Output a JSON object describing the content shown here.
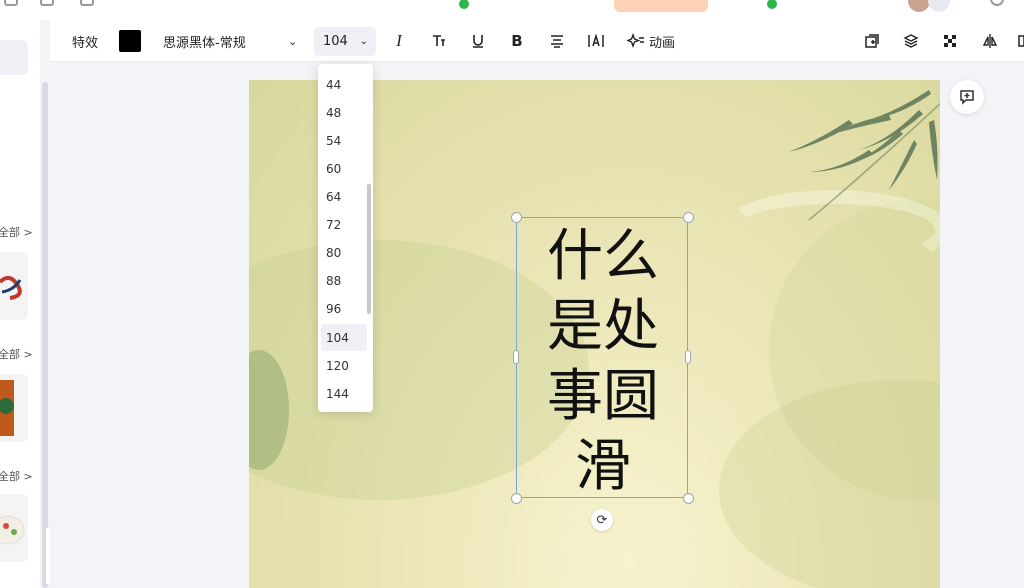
{
  "toolbar": {
    "effects_label": "特效",
    "text_color": "#000000",
    "font_name": "思源黑体-常规",
    "font_size": "104",
    "animation_label": "动画"
  },
  "font_size_dropdown": {
    "options": [
      "44",
      "48",
      "54",
      "60",
      "64",
      "72",
      "80",
      "88",
      "96",
      "104",
      "120",
      "144"
    ],
    "selected": "104"
  },
  "left_panel": {
    "see_all_1": "全部 >",
    "see_all_2": "全部 >",
    "see_all_3": "全部 >"
  },
  "canvas": {
    "text_lines": [
      "什么",
      "是处",
      "事圆",
      "滑"
    ]
  },
  "colors": {
    "accent": "#7ea6dd",
    "canvas_bg": "#e9e5b4"
  }
}
